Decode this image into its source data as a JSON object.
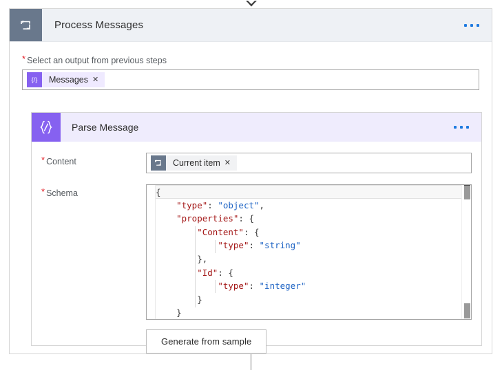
{
  "flow": {
    "top_connector_icon": "chevron-down-icon",
    "bottom_connector": "vertical-connector-line"
  },
  "action_card": {
    "icon": "loop-repeat-icon",
    "title": "Process Messages",
    "menu_icon": "ellipsis-horizontal-icon",
    "field": {
      "required_marker": "*",
      "label": "Select an output from previous steps",
      "token": {
        "icon": "expression-braces-icon",
        "icon_glyph": "{/}",
        "label": "Messages",
        "remove_icon": "close-x-icon",
        "remove_glyph": "✕"
      }
    }
  },
  "parse_card": {
    "icon": "parse-json-icon",
    "icon_glyph": "{/}",
    "title": "Parse Message",
    "menu_icon": "ellipsis-horizontal-icon",
    "content_row": {
      "required_marker": "*",
      "label": "Content",
      "token": {
        "icon": "loop-repeat-icon",
        "label": "Current item",
        "remove_icon": "close-x-icon",
        "remove_glyph": "✕"
      }
    },
    "schema_row": {
      "required_marker": "*",
      "label": "Schema"
    },
    "schema_editor": {
      "lines": [
        {
          "active": true,
          "indent": 0,
          "parts": [
            {
              "t": "{",
              "c": "pun"
            }
          ]
        },
        {
          "active": false,
          "indent": 1,
          "parts": [
            {
              "t": "\"type\"",
              "c": "key"
            },
            {
              "t": ": ",
              "c": "pun"
            },
            {
              "t": "\"object\"",
              "c": "val"
            },
            {
              "t": ",",
              "c": "pun"
            }
          ]
        },
        {
          "active": false,
          "indent": 1,
          "parts": [
            {
              "t": "\"properties\"",
              "c": "key"
            },
            {
              "t": ": {",
              "c": "pun"
            }
          ]
        },
        {
          "active": false,
          "indent": 2,
          "parts": [
            {
              "t": "\"Content\"",
              "c": "key"
            },
            {
              "t": ": {",
              "c": "pun"
            }
          ]
        },
        {
          "active": false,
          "indent": 3,
          "parts": [
            {
              "t": "\"type\"",
              "c": "key"
            },
            {
              "t": ": ",
              "c": "pun"
            },
            {
              "t": "\"string\"",
              "c": "val"
            }
          ]
        },
        {
          "active": false,
          "indent": 2,
          "parts": [
            {
              "t": "},",
              "c": "pun"
            }
          ]
        },
        {
          "active": false,
          "indent": 2,
          "parts": [
            {
              "t": "\"Id\"",
              "c": "key"
            },
            {
              "t": ": {",
              "c": "pun"
            }
          ]
        },
        {
          "active": false,
          "indent": 3,
          "parts": [
            {
              "t": "\"type\"",
              "c": "key"
            },
            {
              "t": ": ",
              "c": "pun"
            },
            {
              "t": "\"integer\"",
              "c": "val"
            }
          ]
        },
        {
          "active": false,
          "indent": 2,
          "parts": [
            {
              "t": "}",
              "c": "pun"
            }
          ]
        },
        {
          "active": false,
          "indent": 1,
          "parts": [
            {
              "t": "}",
              "c": "pun"
            }
          ]
        }
      ],
      "scrollbar": "vertical-scrollbar"
    },
    "generate_button": "Generate from sample"
  },
  "colors": {
    "header_bg": "#eef1f5",
    "header_icon_bg": "#69788c",
    "accent_purple": "#8661f0",
    "token_purple_bg": "#efecfd",
    "menu_dot_blue": "#1d7ae0",
    "required_red": "#e31b23",
    "json_key": "#a31515",
    "json_value": "#1d63c4"
  }
}
